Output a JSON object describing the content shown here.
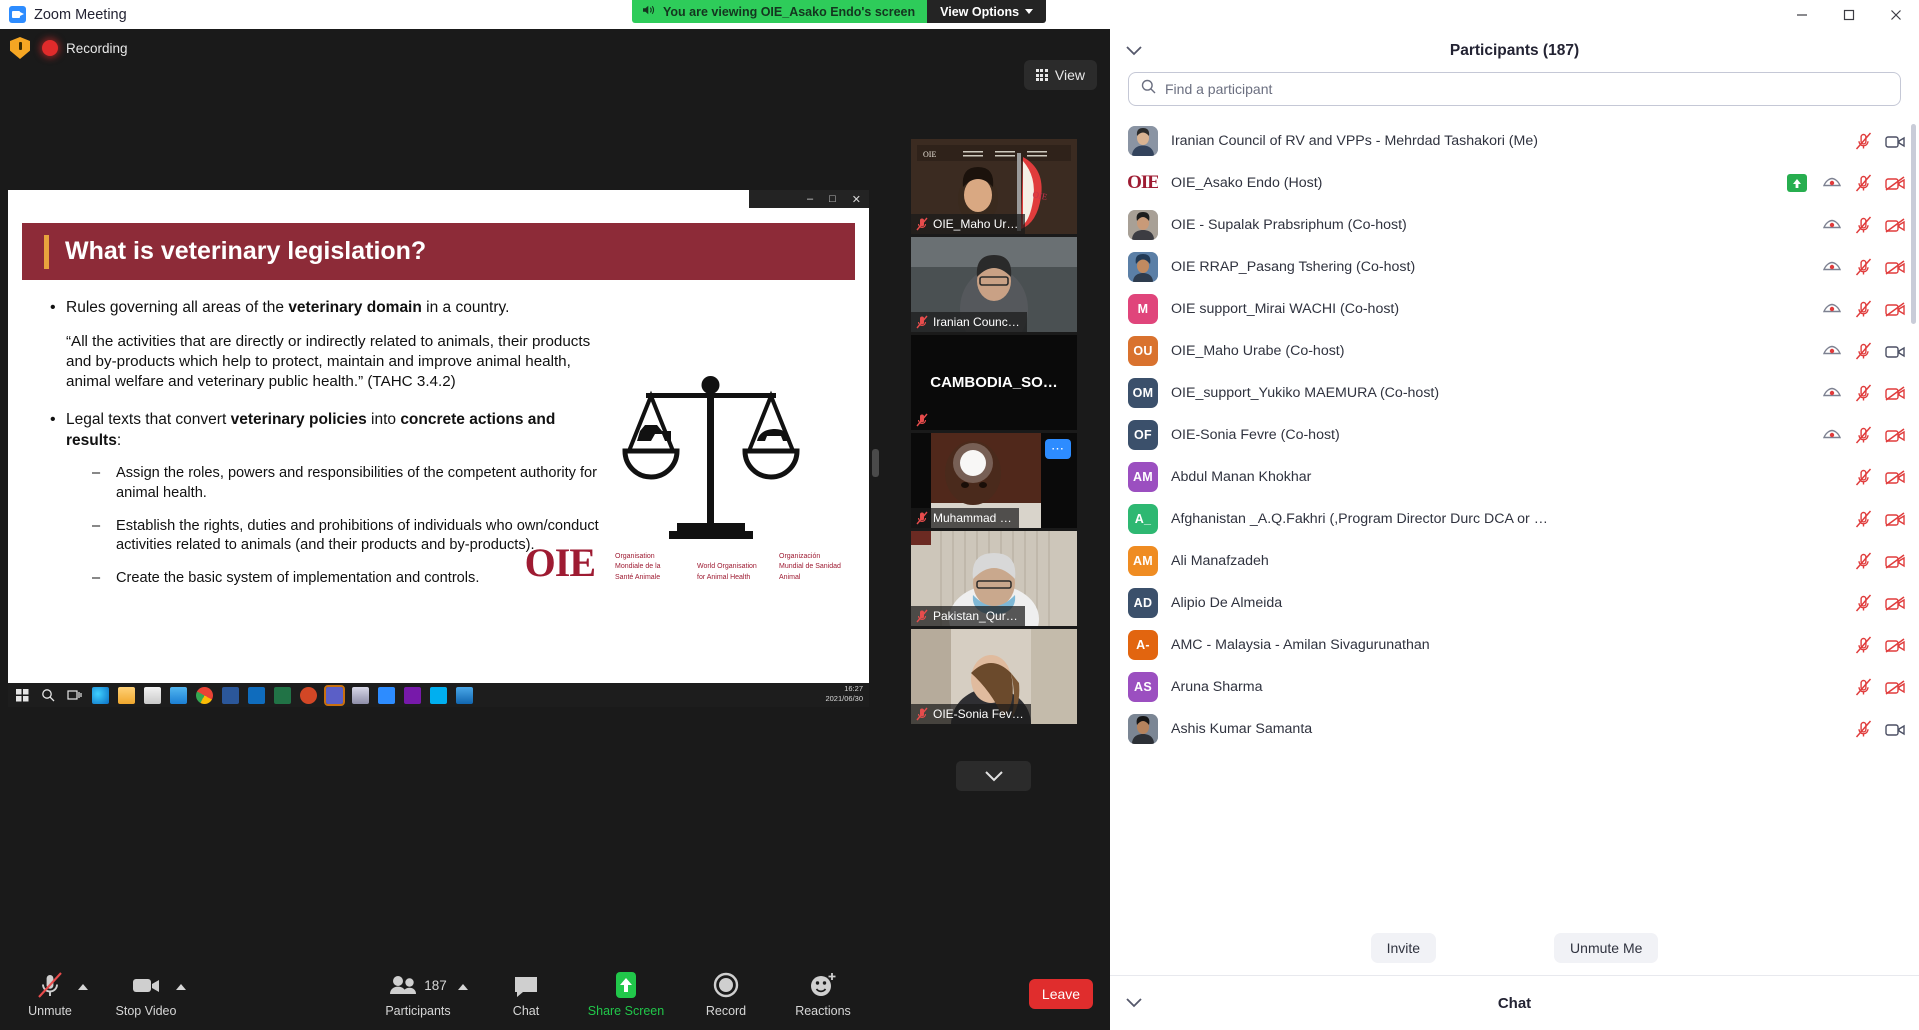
{
  "window": {
    "app_icon": "zoom-video-icon",
    "title": "Zoom Meeting",
    "minimize": "minimize-icon",
    "maximize": "maximize-icon",
    "close": "close-icon"
  },
  "share_notice": {
    "speaker_icon": "speaker-icon",
    "text": "You are viewing OIE_Asako Endo's screen",
    "view_options_label": "View Options",
    "chevron": "chevron-down-icon",
    "green": "#2ecc5a"
  },
  "stage": {
    "shield_icon": "security-shield-icon",
    "record_icon": "recording-dot-icon",
    "record_label": "Recording",
    "view_button_label": "View",
    "view_button_icon": "grid-icon"
  },
  "shared_screen": {
    "ppt_window_controls": [
      "minimize",
      "restore",
      "close"
    ],
    "slide": {
      "title": "What is veterinary legislation?",
      "title_bg": "#8d2b38",
      "accent": "#e8a33d",
      "bullet1_a": "Rules governing all areas of the ",
      "bullet1_b": "veterinary domain",
      "bullet1_c": " in a country.",
      "quote": "“All the activities that are directly or indirectly related to animals, their products and by-products which help to protect, maintain and improve animal health, animal welfare and veterinary public health.” (TAHC 3.4.2)",
      "bullet2_a": "Legal texts that convert ",
      "bullet2_b": "veterinary policies",
      "bullet2_c": " into ",
      "bullet2_d": "concrete actions and results",
      "bullet2_e": ":",
      "sub1": "Assign the roles, powers and responsibilities of the competent authority for animal health.",
      "sub2": "Establish the rights, duties and prohibitions of individuals who own/conduct activities related to animals (and their products and by-products).",
      "sub3": "Create the basic system of implementation and controls.",
      "footer_logo": "OIE",
      "footer_logo_sub": "●●●",
      "footer_org_fr": "Organisation Mondiale de la Santé Animale",
      "footer_org_en": "World Organisation for Animal Health",
      "footer_org_es": "Organización Mundial de Sanidad Animal",
      "image_alt": "scales-of-justice-icon"
    },
    "taskbar": {
      "clock_time": "16:27",
      "clock_date": "2021/06/30",
      "icons": [
        "windows-start-icon",
        "search-icon",
        "task-view-icon",
        "edge-icon",
        "file-explorer-icon",
        "store-icon",
        "people-icon",
        "chrome-icon",
        "word-icon",
        "outlook-icon",
        "excel-icon",
        "powerpoint-icon",
        "teams-icon",
        "paint-icon",
        "zoom-icon",
        "onenote-icon",
        "skype-icon",
        "media-player-icon"
      ]
    }
  },
  "filmstrip": {
    "scroll_down_icon": "chevron-down-icon",
    "thumbs": [
      {
        "name": "OIE_Maho Ur…",
        "muted": true,
        "art": "t1",
        "active": false,
        "center_text": ""
      },
      {
        "name": "Iranian Counc…",
        "muted": true,
        "art": "t2",
        "active": false,
        "center_text": ""
      },
      {
        "name": "",
        "muted": true,
        "art": "t3",
        "active": false,
        "center_text": "CAMBODIA_SO…"
      },
      {
        "name": "Muhammad …",
        "muted": true,
        "art": "t4",
        "active": true,
        "center_text": "",
        "more_icon": "more-options-icon"
      },
      {
        "name": "Pakistan_Qur…",
        "muted": true,
        "art": "t5",
        "active": false,
        "center_text": ""
      },
      {
        "name": "OIE-Sonia Fev…",
        "muted": true,
        "art": "t6",
        "active": false,
        "center_text": ""
      }
    ]
  },
  "controls": {
    "items": [
      {
        "icon": "mic-muted-icon",
        "label": "Unmute",
        "caret": true,
        "green": false
      },
      {
        "icon": "video-icon",
        "label": "Stop Video",
        "caret": true,
        "green": false
      },
      {
        "icon": "participants-icon",
        "label": "Participants",
        "caret": true,
        "count": "187",
        "green": false
      },
      {
        "icon": "chat-bubble-icon",
        "label": "Chat",
        "caret": false,
        "green": false
      },
      {
        "icon": "share-screen-icon",
        "label": "Share Screen",
        "caret": false,
        "green": true
      },
      {
        "icon": "record-icon",
        "label": "Record",
        "caret": false,
        "green": false
      },
      {
        "icon": "reactions-icon",
        "label": "Reactions",
        "caret": false,
        "green": false
      }
    ],
    "leave_label": "Leave",
    "leave_color": "#e02d2d",
    "share_green": "#21c74a"
  },
  "participants_panel": {
    "collapse_icon": "chevron-down-icon",
    "title": "Participants (187)",
    "search": {
      "icon": "search-icon",
      "placeholder": "Find a participant",
      "value": ""
    },
    "rows": [
      {
        "avatar_type": "photo",
        "initials": "",
        "color": "#7f8ea3",
        "name": "Iranian Council of RV and VPPs - Mehrdad Tashakori (Me)",
        "raise_hand": false,
        "video_shared": false,
        "mic": "muted",
        "camera": "on"
      },
      {
        "avatar_type": "logo",
        "initials": "OIE",
        "color": "#9e1b32",
        "name": "OIE_Asako Endo (Host)",
        "raise_hand": false,
        "video_shared": true,
        "mic": "muted",
        "camera": "off",
        "share_badge": "screen-share-badge"
      },
      {
        "avatar_type": "photo",
        "initials": "",
        "color": "#8d7f76",
        "name": "OIE - Supalak Prabsriphum (Co-host)",
        "raise_hand": false,
        "video_shared": true,
        "mic": "muted",
        "camera": "off"
      },
      {
        "avatar_type": "photo",
        "initials": "",
        "color": "#4f6f8f",
        "name": "OIE RRAP_Pasang Tshering (Co-host)",
        "raise_hand": false,
        "video_shared": true,
        "mic": "muted",
        "camera": "off"
      },
      {
        "avatar_type": "initials",
        "initials": "M",
        "color": "#e0457b",
        "name": "OIE support_Mirai WACHI (Co-host)",
        "raise_hand": false,
        "video_shared": true,
        "mic": "muted",
        "camera": "off"
      },
      {
        "avatar_type": "initials",
        "initials": "OU",
        "color": "#d9722e",
        "name": "OIE_Maho Urabe (Co-host)",
        "raise_hand": false,
        "video_shared": true,
        "mic": "muted",
        "camera": "on"
      },
      {
        "avatar_type": "initials",
        "initials": "OM",
        "color": "#3b506b",
        "name": "OIE_support_Yukiko MAEMURA (Co-host)",
        "raise_hand": false,
        "video_shared": true,
        "mic": "muted",
        "camera": "off"
      },
      {
        "avatar_type": "initials",
        "initials": "OF",
        "color": "#3b506b",
        "name": "OIE-Sonia Fevre (Co-host)",
        "raise_hand": false,
        "video_shared": true,
        "mic": "muted",
        "camera": "on"
      },
      {
        "avatar_type": "initials",
        "initials": "AM",
        "color": "#9b4fc0",
        "name": "Abdul Manan Khokhar",
        "raise_hand": false,
        "video_shared": false,
        "mic": "muted",
        "camera": "off"
      },
      {
        "avatar_type": "initials",
        "initials": "A_",
        "color": "#2eb872",
        "name": "Afghanistan _A.Q.Fakhri (,Program Director Durc DCA or …",
        "raise_hand": false,
        "video_shared": false,
        "mic": "muted",
        "camera": "off"
      },
      {
        "avatar_type": "initials",
        "initials": "AM",
        "color": "#ef8c22",
        "name": "Ali Manafzadeh",
        "raise_hand": false,
        "video_shared": false,
        "mic": "muted",
        "camera": "off"
      },
      {
        "avatar_type": "initials",
        "initials": "AD",
        "color": "#3b506b",
        "name": "Alipio De Almeida",
        "raise_hand": false,
        "video_shared": false,
        "mic": "muted",
        "camera": "off"
      },
      {
        "avatar_type": "initials",
        "initials": "A-",
        "color": "#e2650f",
        "name": "AMC - Malaysia  -  Amilan Sivagurunathan",
        "raise_hand": false,
        "video_shared": false,
        "mic": "muted",
        "camera": "off"
      },
      {
        "avatar_type": "initials",
        "initials": "AS",
        "color": "#9b4fc0",
        "name": "Aruna Sharma",
        "raise_hand": false,
        "video_shared": false,
        "mic": "muted",
        "camera": "off"
      },
      {
        "avatar_type": "photo",
        "initials": "",
        "color": "#6e7c8c",
        "name": "Ashis Kumar Samanta",
        "raise_hand": false,
        "video_shared": false,
        "mic": "muted",
        "camera": "on"
      }
    ],
    "invite_label": "Invite",
    "unmute_me_label": "Unmute Me"
  },
  "chat_panel": {
    "collapse_icon": "chevron-down-icon",
    "title": "Chat"
  }
}
